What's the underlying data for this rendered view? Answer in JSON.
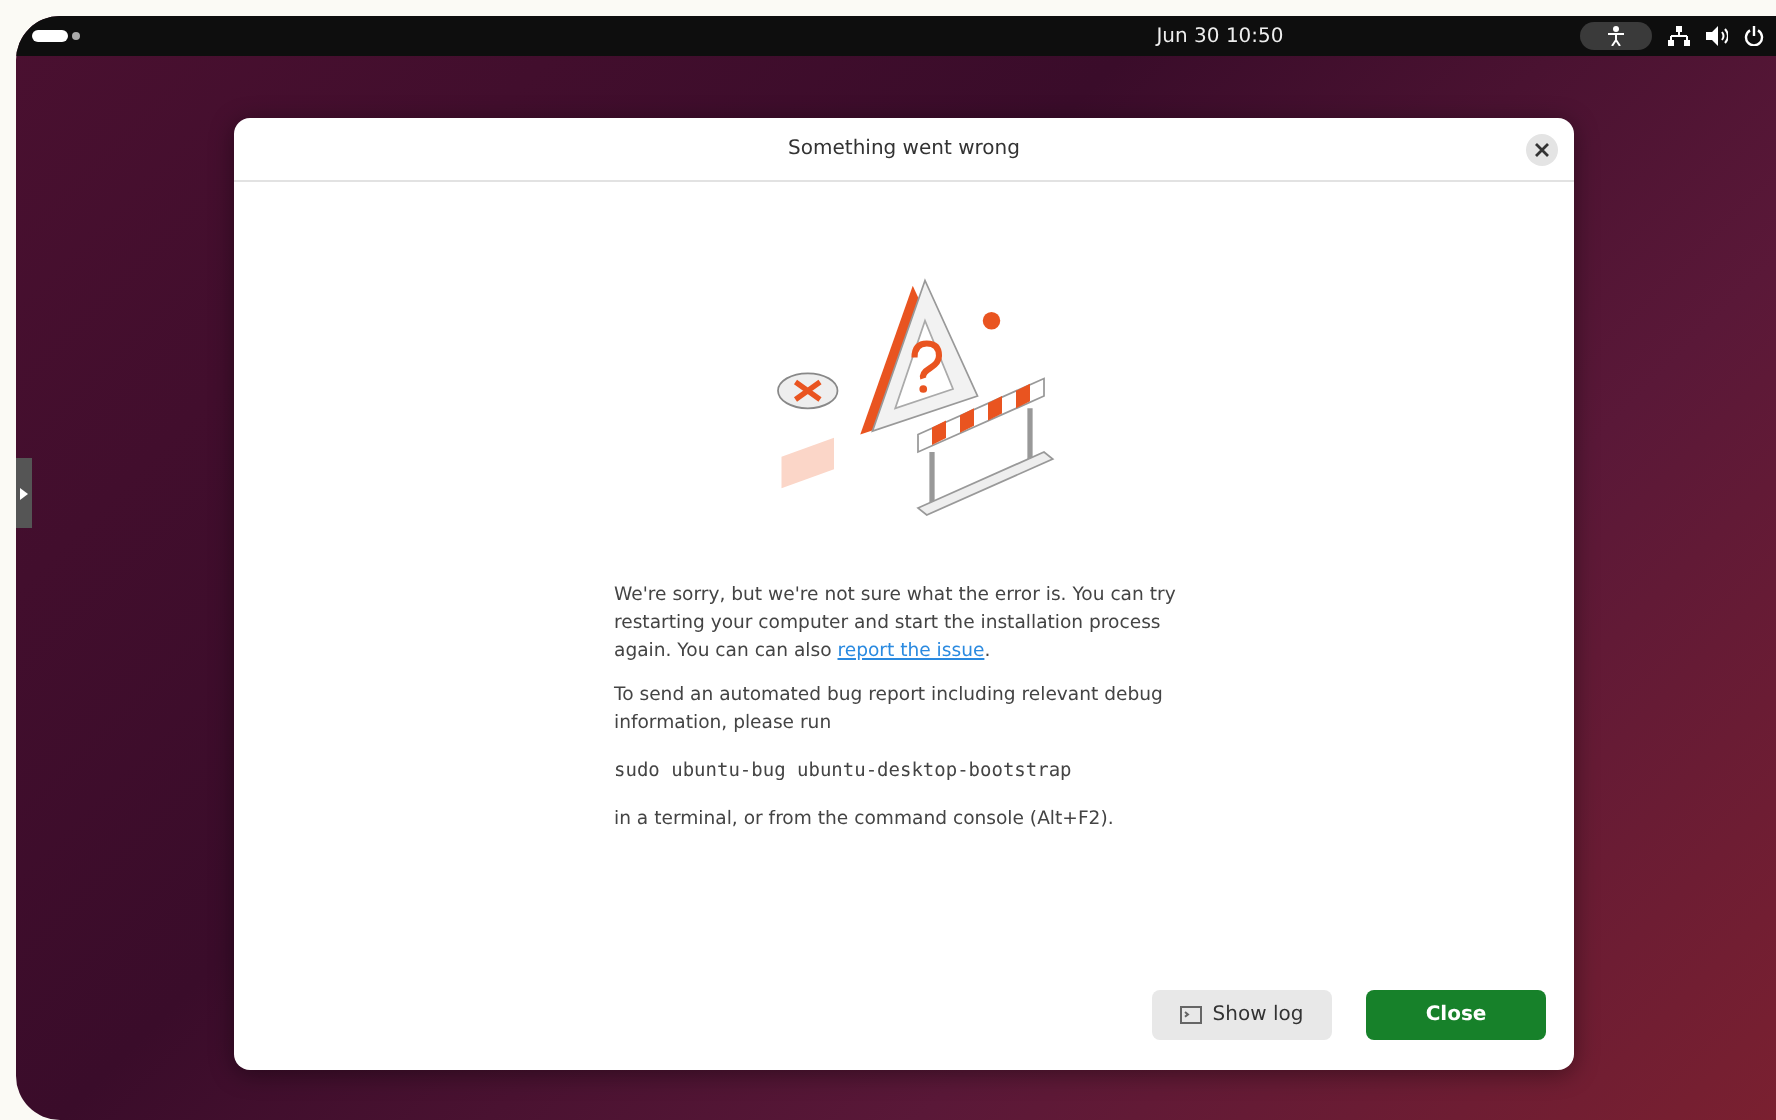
{
  "top_bar": {
    "clock": "Jun 30  10:50"
  },
  "dialog": {
    "title": "Something went wrong",
    "paragraphs": [
      {
        "kind": "text",
        "text": "We're sorry, but we're not sure what the error is. You can try restarting your computer and start the installation process again. You can can also ",
        "link": "report the issue",
        "after": "."
      },
      {
        "kind": "text",
        "text": "To send an automated bug report including relevant debug information, please run"
      },
      {
        "kind": "code",
        "text": "sudo ubuntu-bug ubuntu-desktop-bootstrap"
      },
      {
        "kind": "text",
        "text": "in a terminal, or from the command console (Alt+F2)."
      }
    ],
    "buttons": [
      {
        "label": "Show log",
        "kind": "secondary"
      },
      {
        "label": "Close",
        "kind": "primary"
      }
    ]
  }
}
